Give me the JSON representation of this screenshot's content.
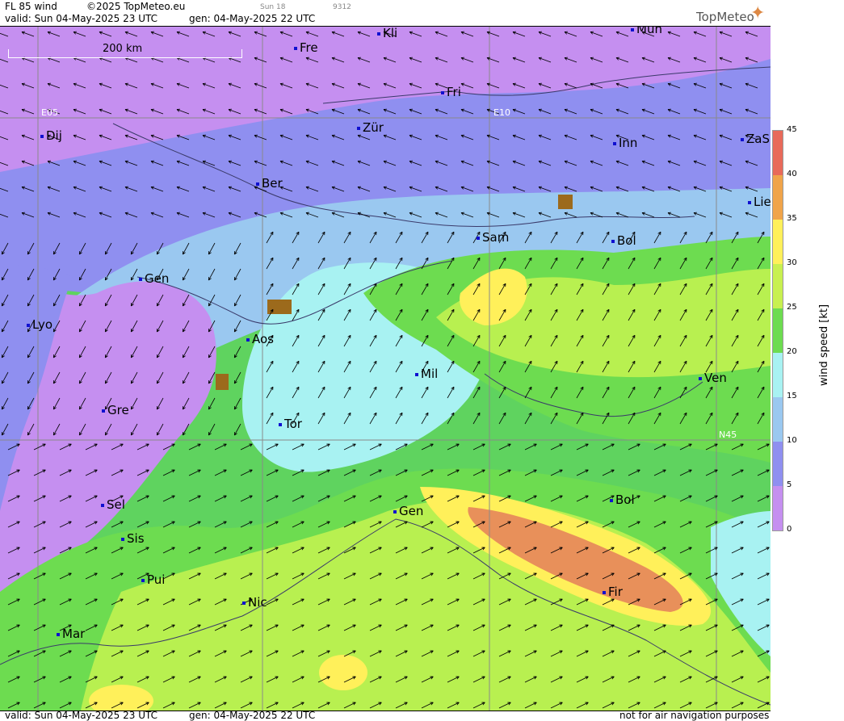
{
  "header": {
    "product": "FL 85 wind",
    "copyright": "©2025 TopMeteo.eu",
    "valid": "valid:  Sun  04-May-2025  23 UTC",
    "gen": "gen: 04-May-2025 22 UTC",
    "small1": "Sun 18",
    "small2": "9312",
    "logo": "TopMeteo"
  },
  "footer": {
    "valid": "valid:  Sun  04-May-2025  23 UTC",
    "gen": "gen: 04-May-2025 22 UTC",
    "disclaimer": "not for air navigation purposes"
  },
  "scale": {
    "label": "200 km"
  },
  "grid_labels": {
    "e05": "E05",
    "e10": "E10",
    "n45": "N45"
  },
  "cities": [
    "Kli",
    "Mun",
    "Fre",
    "Fri",
    "Dij",
    "Zür",
    "Inn",
    "ZaS",
    "Ber",
    "Lie",
    "Sam",
    "Bol",
    "Gen",
    "Lyo",
    "Aos",
    "Mil",
    "Ven",
    "Gre",
    "Tor",
    "Sel",
    "Gen",
    "Bol",
    "Sis",
    "Pui",
    "Nic",
    "Fir",
    "Mar"
  ],
  "colorbar": {
    "title": "wind speed [kt]",
    "ticks": [
      "45",
      "40",
      "35",
      "30",
      "25",
      "20",
      "15",
      "10",
      "5",
      "0"
    ],
    "colors": [
      "#e86a5a",
      "#f0a44a",
      "#fff05a",
      "#c8f050",
      "#6ddc50",
      "#a8f2f2",
      "#9ac8f0",
      "#8f8ff0",
      "#c58ff0"
    ]
  },
  "map_colors": {
    "calm": "#c58ff0",
    "light": "#8f8ff0",
    "moderate": "#9ac8f0",
    "fresh": "#a8f2f2",
    "strong": "#6ddc50",
    "stronger": "#b8f050",
    "yellow": "#fff05a",
    "orange": "#e8905a",
    "terrain": "#9c6a1c"
  }
}
